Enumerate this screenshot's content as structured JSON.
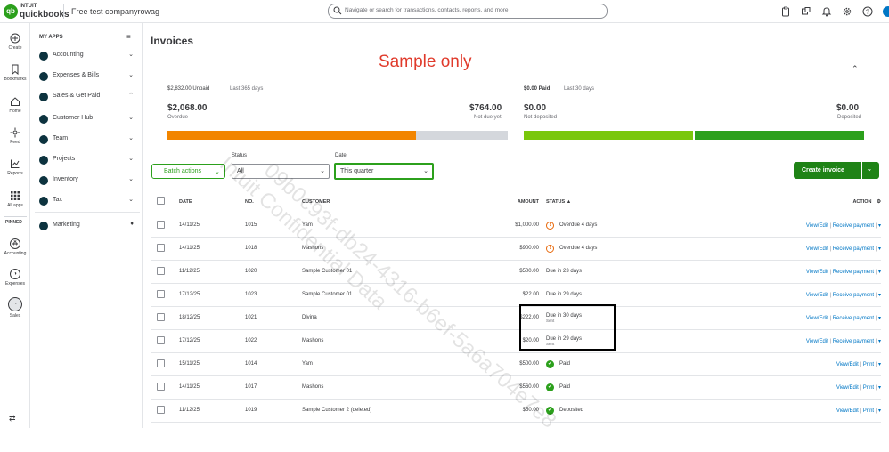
{
  "topbar": {
    "logo_mark": "qb",
    "logo_top": "INTUIT",
    "logo_name": "quickbooks",
    "company": "Free test companyrowag",
    "search_placeholder": "Navigate or search for transactions, contacts, reports, and more",
    "icons": [
      "clipboard-icon",
      "apps-icon",
      "bell-icon",
      "gear-icon",
      "help-icon"
    ]
  },
  "rail": {
    "create": "Create",
    "bookmarks": "Bookmarks",
    "home": "Home",
    "feed": "Feed",
    "reports": "Reports",
    "all_apps": "All apps",
    "pinned": "PINNED",
    "accounting": "Accounting",
    "expenses": "Expenses",
    "sales": "Sales"
  },
  "sidebar": {
    "header": "MY APPS",
    "items": [
      {
        "label": "Accounting",
        "chevron": "⌄"
      },
      {
        "label": "Expenses & Bills",
        "chevron": "⌄"
      },
      {
        "label": "Sales & Get Paid",
        "chevron": "⌃"
      },
      {
        "label": "Customer Hub",
        "chevron": "⌄"
      },
      {
        "label": "Team",
        "chevron": "⌄"
      },
      {
        "label": "Projects",
        "chevron": "⌄"
      },
      {
        "label": "Inventory",
        "chevron": "⌄"
      },
      {
        "label": "Tax",
        "chevron": "⌄"
      },
      {
        "label": "Marketing",
        "chevron": "♦"
      }
    ]
  },
  "page": {
    "title": "Invoices",
    "sample_label": "Sample only",
    "watermark": "09b0c93f-db24-4316-b6ef-5a6a704e7e8",
    "watermark2": "Intuit Confidential Data"
  },
  "summary": {
    "unpaid_total": "$2,832.00 Unpaid",
    "unpaid_period": "Last 365 days",
    "overdue_amount": "$2,068.00",
    "overdue_label": "Overdue",
    "not_due_amount": "$764.00",
    "not_due_label": "Not due yet",
    "paid_total": "$0.00 Paid",
    "paid_period": "Last 30 days",
    "not_deposited_amount": "$0.00",
    "not_deposited_label": "Not deposited",
    "deposited_amount": "$0.00",
    "deposited_label": "Deposited",
    "overdue_fraction": 0.73,
    "not_deposited_fraction": 0.5,
    "colors": {
      "overdue": "#f28500",
      "not_due": "#d4d7dc",
      "not_deposited": "#7ac70c",
      "deposited": "#2ca01c"
    }
  },
  "filters": {
    "batch_actions": "Batch actions",
    "status_label": "Status",
    "status_value": "All",
    "date_label": "Date",
    "date_value": "This quarter",
    "create_invoice": "Create invoice"
  },
  "table": {
    "headers": {
      "date": "DATE",
      "no": "NO.",
      "customer": "CUSTOMER",
      "amount": "AMOUNT",
      "status": "STATUS ▲",
      "action": "ACTION"
    },
    "rows": [
      {
        "date": "14/11/25",
        "no": "1015",
        "customer": "Yam",
        "amount": "$1,000.00",
        "status": "Overdue 4 days",
        "status_sub": "",
        "kind": "warn",
        "action1": "View/Edit",
        "action2": "Receive payment"
      },
      {
        "date": "14/11/25",
        "no": "1018",
        "customer": "Mashons",
        "amount": "$900.00",
        "status": "Overdue 4 days",
        "status_sub": "",
        "kind": "warn",
        "action1": "View/Edit",
        "action2": "Receive payment"
      },
      {
        "date": "11/12/25",
        "no": "1020",
        "customer": "Sample Customer 01",
        "amount": "$500.00",
        "status": "Due in 23 days",
        "status_sub": "",
        "kind": "none",
        "action1": "View/Edit",
        "action2": "Receive payment"
      },
      {
        "date": "17/12/25",
        "no": "1023",
        "customer": "Sample Customer 01",
        "amount": "$22.00",
        "status": "Due in 29 days",
        "status_sub": "",
        "kind": "none",
        "action1": "View/Edit",
        "action2": "Receive payment"
      },
      {
        "date": "18/12/25",
        "no": "1021",
        "customer": "Divina",
        "amount": "$222.00",
        "status": "Due in 30 days",
        "status_sub": "Sent",
        "kind": "none",
        "action1": "View/Edit",
        "action2": "Receive payment"
      },
      {
        "date": "17/12/25",
        "no": "1022",
        "customer": "Mashons",
        "amount": "$20.00",
        "status": "Due in 29 days",
        "status_sub": "Sent",
        "kind": "none",
        "action1": "View/Edit",
        "action2": "Receive payment"
      },
      {
        "date": "15/11/25",
        "no": "1014",
        "customer": "Yam",
        "amount": "$500.00",
        "status": "Paid",
        "status_sub": "",
        "kind": "ok",
        "action1": "View/Edit",
        "action2": "Print"
      },
      {
        "date": "14/11/25",
        "no": "1017",
        "customer": "Mashons",
        "amount": "$560.00",
        "status": "Paid",
        "status_sub": "",
        "kind": "ok",
        "action1": "View/Edit",
        "action2": "Print"
      },
      {
        "date": "11/12/25",
        "no": "1019",
        "customer": "Sample Customer 2 (deleted)",
        "amount": "$50.00",
        "status": "Deposited",
        "status_sub": "",
        "kind": "ok",
        "action1": "View/Edit",
        "action2": "Print"
      }
    ]
  }
}
